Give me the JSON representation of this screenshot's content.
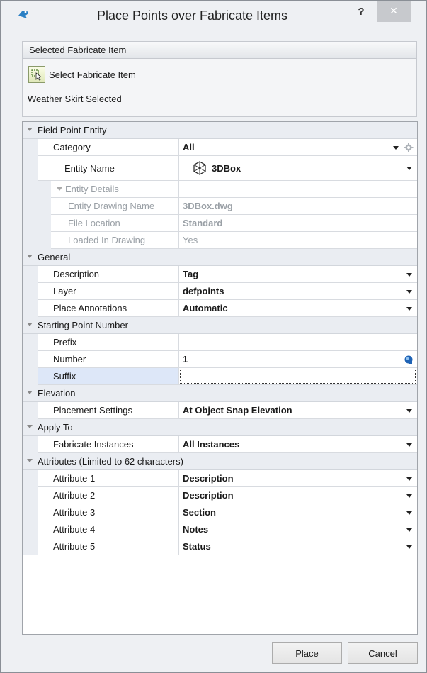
{
  "window": {
    "title": "Place Points over Fabricate Items",
    "help_label": "?",
    "close_label": "✕"
  },
  "selection": {
    "group_title": "Selected Fabricate Item",
    "select_button_label": "Select Fabricate Item",
    "status": "Weather Skirt Selected"
  },
  "grid": {
    "field_point_entity": {
      "label": "Field Point Entity",
      "category": {
        "name": "Category",
        "value": "All"
      },
      "entity_name": {
        "name": "Entity Name",
        "value": "3DBox"
      },
      "entity_details": {
        "label": "Entity Details",
        "drawing_name": {
          "name": "Entity Drawing Name",
          "value": "3DBox.dwg"
        },
        "file_location": {
          "name": "File Location",
          "value": "Standard"
        },
        "loaded": {
          "name": "Loaded In Drawing",
          "value": "Yes"
        }
      }
    },
    "general": {
      "label": "General",
      "description": {
        "name": "Description",
        "value": "Tag"
      },
      "layer": {
        "name": "Layer",
        "value": "defpoints"
      },
      "place_annotations": {
        "name": "Place Annotations",
        "value": "Automatic"
      }
    },
    "starting_point_number": {
      "label": "Starting Point Number",
      "prefix": {
        "name": "Prefix",
        "value": ""
      },
      "number": {
        "name": "Number",
        "value": "1"
      },
      "suffix": {
        "name": "Suffix",
        "value": ""
      }
    },
    "elevation": {
      "label": "Elevation",
      "placement": {
        "name": "Placement Settings",
        "value": "At Object Snap Elevation"
      }
    },
    "apply_to": {
      "label": "Apply To",
      "instances": {
        "name": "Fabricate Instances",
        "value": "All Instances"
      }
    },
    "attributes": {
      "label": "Attributes (Limited to 62 characters)",
      "items": [
        {
          "name": "Attribute 1",
          "value": "Description"
        },
        {
          "name": "Attribute 2",
          "value": "Description"
        },
        {
          "name": "Attribute 3",
          "value": "Section"
        },
        {
          "name": "Attribute 4",
          "value": "Notes"
        },
        {
          "name": "Attribute 5",
          "value": "Status"
        }
      ]
    }
  },
  "buttons": {
    "place": "Place",
    "cancel": "Cancel"
  }
}
